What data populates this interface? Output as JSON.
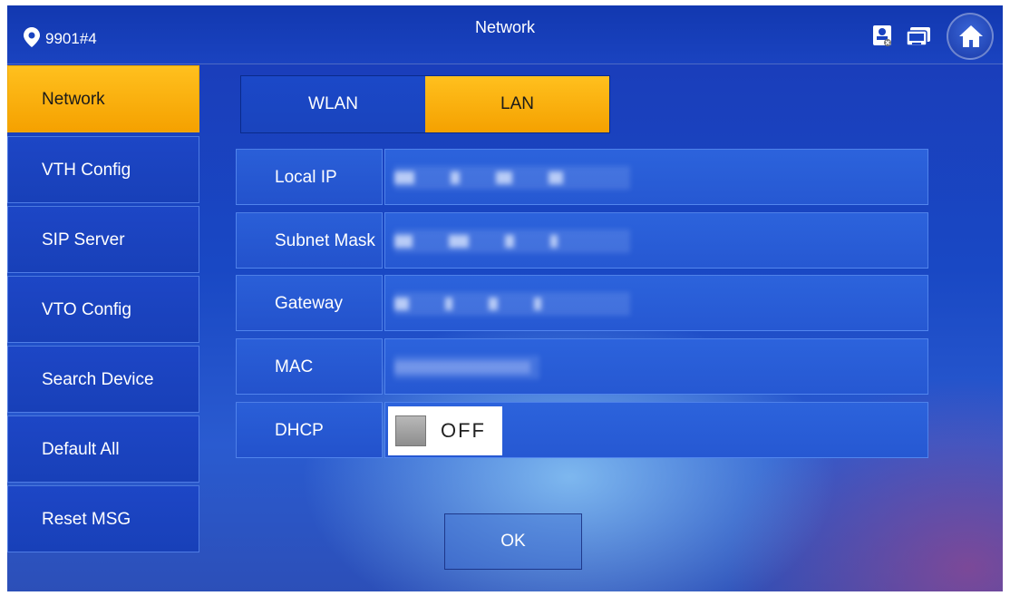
{
  "header": {
    "location": "9901#4",
    "title": "Network",
    "icons": [
      "location-pin-icon",
      "contact-status-icon",
      "monitor-icon",
      "home-icon"
    ]
  },
  "sidebar": {
    "items": [
      {
        "label": "Network",
        "active": true
      },
      {
        "label": "VTH Config",
        "active": false
      },
      {
        "label": "SIP Server",
        "active": false
      },
      {
        "label": "VTO Config",
        "active": false
      },
      {
        "label": "Search Device",
        "active": false
      },
      {
        "label": "Default All",
        "active": false
      },
      {
        "label": "Reset MSG",
        "active": false
      }
    ]
  },
  "tabs": [
    {
      "label": "WLAN",
      "active": false
    },
    {
      "label": "LAN",
      "active": true
    }
  ],
  "fields": {
    "local_ip": {
      "label": "Local IP"
    },
    "subnet_mask": {
      "label": "Subnet Mask"
    },
    "gateway": {
      "label": "Gateway"
    },
    "mac": {
      "label": "MAC"
    },
    "dhcp": {
      "label": "DHCP",
      "value": "OFF"
    }
  },
  "ok_label": "OK",
  "colors": {
    "accent": "#f5a100",
    "background": "#1a44c0"
  }
}
